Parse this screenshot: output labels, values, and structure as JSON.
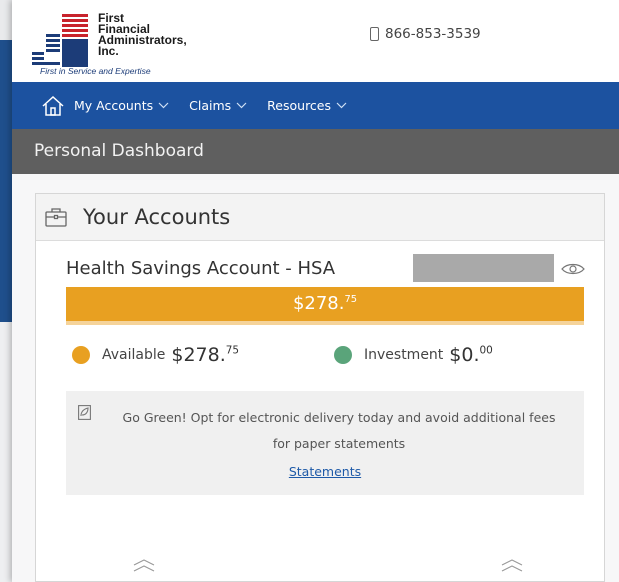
{
  "logo": {
    "lines": [
      "First",
      "Financial",
      "Administrators,",
      "Inc."
    ],
    "tagline": "First in Service and Expertise",
    "colors": {
      "red": "#c8232c",
      "blue": "#1c3c78"
    }
  },
  "header": {
    "phone_icon": "phone-icon",
    "phone": "866-853-3539"
  },
  "nav": {
    "home_icon": "home-icon",
    "items": [
      {
        "label": "My Accounts"
      },
      {
        "label": "Claims"
      },
      {
        "label": "Resources"
      }
    ]
  },
  "subheader": {
    "title": "Personal Dashboard"
  },
  "card": {
    "icon": "briefcase-icon",
    "title": "Your Accounts",
    "account": {
      "name": "Health Savings Account - HSA",
      "masked_number_icon": "eye-icon",
      "balance_main": "$278.",
      "balance_cents": "75",
      "bar_color": "#e8a021",
      "available": {
        "label": "Available",
        "main": "$278.",
        "cents": "75",
        "color": "#e8a021"
      },
      "investment": {
        "label": "Investment",
        "main": "$0.",
        "cents": "00",
        "color": "#5aa47a"
      }
    },
    "notice": {
      "icon": "leaf-icon",
      "line1": "Go Green! Opt for electronic delivery today and avoid additional fees",
      "line2": "for paper statements",
      "link": "Statements"
    },
    "footer_icons": [
      "chevron-up-icon",
      "chevron-up-icon"
    ]
  }
}
